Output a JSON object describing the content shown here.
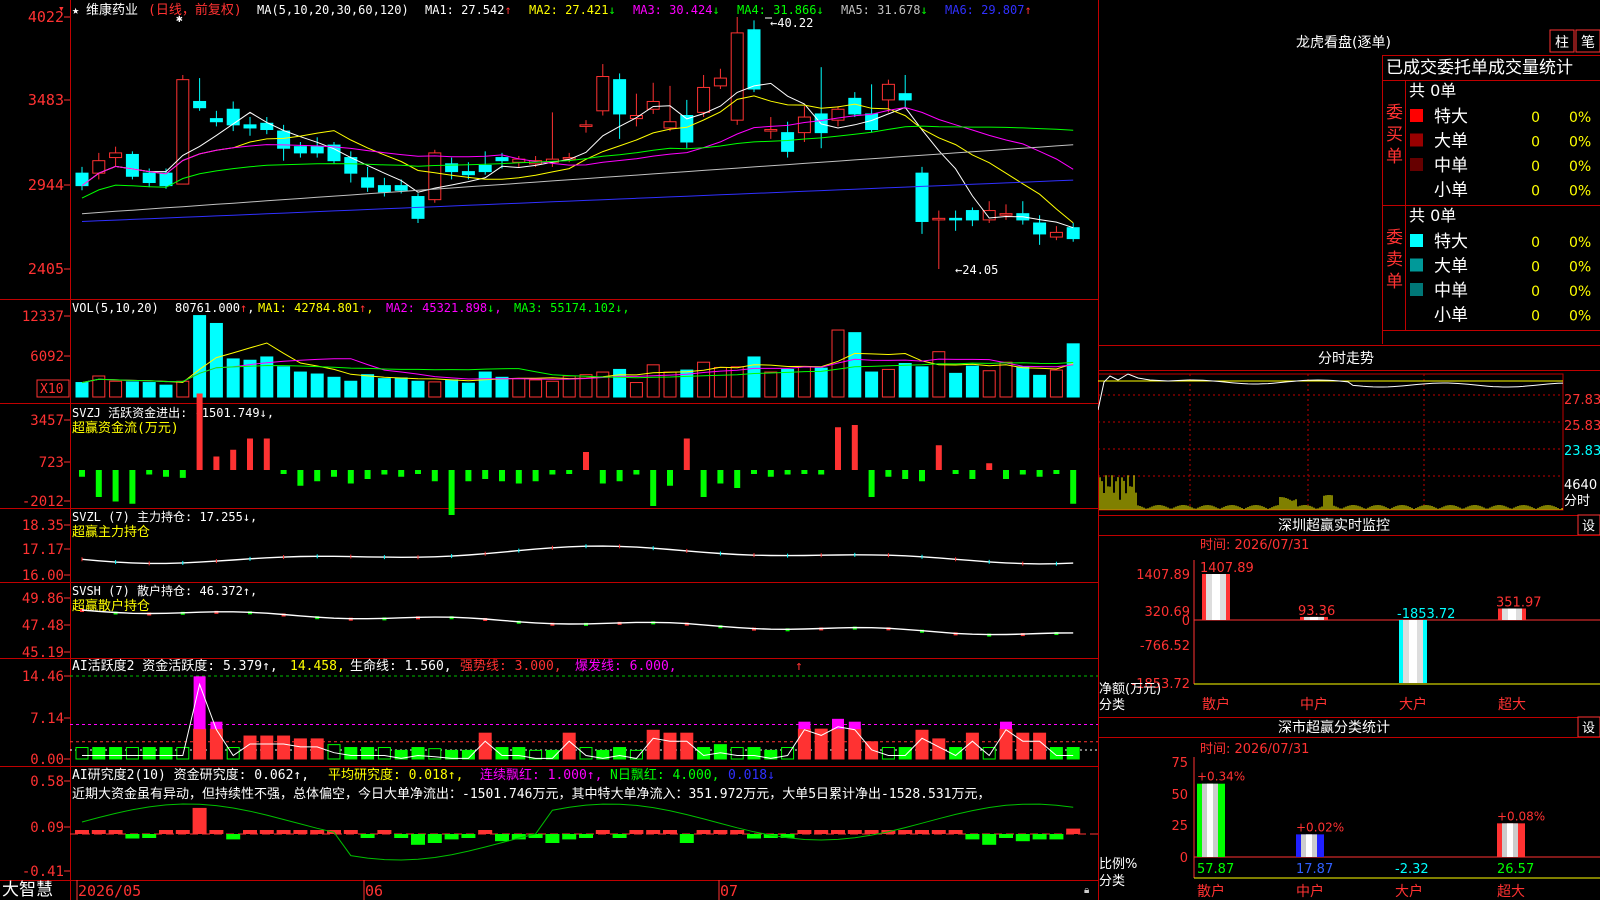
{
  "app": {
    "name": "大智慧"
  },
  "stock": {
    "star": "★",
    "name": "维康药业",
    "period": "(日线，前复权)"
  },
  "colors": {
    "up": "#ff3232",
    "down": "#00ffff",
    "grid": "#a00000",
    "axis": "#ff3232",
    "bg": "#000000"
  },
  "kline": {
    "ma_header": "MA(5,10,20,30,60,120)",
    "ma": [
      {
        "label": "MA1: 27.542",
        "arrow": "↑",
        "color": "#ffffff"
      },
      {
        "label": "MA2: 27.421",
        "arrow": "↓",
        "color": "#ffff00"
      },
      {
        "label": "MA3: 30.424",
        "arrow": "↓",
        "color": "#ff00ff"
      },
      {
        "label": "MA4: 31.866",
        "arrow": "↓",
        "color": "#00ff00"
      },
      {
        "label": "MA5: 31.678",
        "arrow": "↓",
        "color": "#c0c0c0"
      },
      {
        "label": "MA6: 29.807",
        "arrow": "↑",
        "color": "#3030ff"
      }
    ],
    "price_axis": [
      "4022",
      "3483",
      "2944",
      "2405"
    ],
    "high_label": "40.22",
    "low_label": "←24.05"
  },
  "volume": {
    "header": "VOL(5,10,20)",
    "value": "80761.000",
    "ma": [
      {
        "label": "MA1: 42784.801",
        "arrow": "↑",
        "color": "#ffff00"
      },
      {
        "label": "MA2: 45321.898",
        "arrow": "↓",
        "color": "#ff00ff"
      },
      {
        "label": "MA3: 55174.102",
        "arrow": "↓",
        "color": "#00ff00"
      }
    ],
    "axis": [
      "12337",
      "6092"
    ],
    "unit": "X10"
  },
  "svzj": {
    "header": "SVZJ  活跃资金进出: -1501.749↓,",
    "sub": "超赢资金流(万元)",
    "axis": [
      "3457",
      "723",
      "-2012"
    ]
  },
  "svzl": {
    "header": "SVZL (7) 主力持仓: 17.255↓,",
    "sub": "超赢主力持仓",
    "axis": [
      "18.35",
      "17.17",
      "16.00"
    ]
  },
  "svsh": {
    "header": "SVSH (7) 散户持仓: 46.372↑,",
    "sub": "超赢散户持仓",
    "axis": [
      "49.86",
      "47.48",
      "45.19"
    ]
  },
  "ai_active": {
    "parts": [
      {
        "text": "AI活跃度2 资金活跃度: 5.379↑,",
        "color": "#ffffff"
      },
      {
        "text": "14.458,",
        "color": "#ffff00"
      },
      {
        "text": "生命线: 1.560,",
        "color": "#ffffff"
      },
      {
        "text": "强势线: 3.000,",
        "color": "#ff3232"
      },
      {
        "text": "爆发线: 6.000,",
        "color": "#ff00ff"
      }
    ],
    "axis": [
      "14.46",
      "7.14",
      "0.00"
    ]
  },
  "ai_research": {
    "parts": [
      {
        "text": "AI研究度2(10) 资金研究度: 0.062↑,",
        "color": "#ffffff"
      },
      {
        "text": "平均研究度: 0.018↑,",
        "color": "#ffff00"
      },
      {
        "text": "连续飘红: 1.000↑,",
        "color": "#ff00ff"
      },
      {
        "text": "N日飘红: 4.000,",
        "color": "#00ff00"
      },
      {
        "text": "0.018↓",
        "color": "#3030ff"
      }
    ],
    "comment": "近期大资金虽有异动，但持续性不强，总体偏空，今日大单净流出：-1501.746万元，其中特大单净流入：351.972万元，大单5日累计净出-1528.531万元，",
    "axis": [
      "0.58",
      "0.09",
      "-0.41"
    ]
  },
  "dates": [
    "2026/05",
    "06",
    "07"
  ],
  "side": {
    "lhb": {
      "title": "龙虎看盘(逐单)",
      "btn1": "柱",
      "btn2": "笔",
      "table_title": "已成交委托单成交量统计",
      "buy": {
        "label": "委买单",
        "total": "共 0单",
        "rows": [
          {
            "name": "特大",
            "vol": "0",
            "pct": "0%",
            "color": "#ff0000"
          },
          {
            "name": "大单",
            "vol": "0",
            "pct": "0%",
            "color": "#990000"
          },
          {
            "name": "中单",
            "vol": "0",
            "pct": "0%",
            "color": "#660000"
          },
          {
            "name": "小单",
            "vol": "0",
            "pct": "0%",
            "color": ""
          }
        ]
      },
      "sell": {
        "label": "委卖单",
        "total": "共 0单",
        "rows": [
          {
            "name": "特大",
            "vol": "0",
            "pct": "0%",
            "color": "#00ffff"
          },
          {
            "name": "大单",
            "vol": "0",
            "pct": "0%",
            "color": "#009999"
          },
          {
            "name": "中单",
            "vol": "0",
            "pct": "0%",
            "color": "#007777"
          },
          {
            "name": "小单",
            "vol": "0",
            "pct": "0%",
            "color": ""
          }
        ]
      }
    },
    "minute": {
      "title": "分时走势",
      "axis": [
        "27.83",
        "25.83",
        "23.83"
      ],
      "vol_label": "4640",
      "unit_label": "分时"
    },
    "sz_monitor": {
      "title": "深圳超赢实时监控",
      "set": "设",
      "time": "时间: 2026/07/31",
      "axis": [
        "1407.89",
        "320.69",
        "0",
        "-766.52",
        "-1853.72"
      ],
      "ylabel1": "净额(万元)",
      "ylabel2": "分类",
      "bars": [
        {
          "cat": "散户",
          "value": 1407.89,
          "label": "1407.89",
          "color": "#ff3232"
        },
        {
          "cat": "中户",
          "value": 93.36,
          "label": "93.36",
          "color": "#ff3232"
        },
        {
          "cat": "大户",
          "value": -1853.72,
          "label": "-1853.72",
          "color": "#00ffff"
        },
        {
          "cat": "超大",
          "value": 351.97,
          "label": "351.97",
          "color": "#ff3232"
        }
      ]
    },
    "sz_class": {
      "title": "深市超赢分类统计",
      "set": "设",
      "time": "时间: 2026/07/31",
      "axis": [
        "75",
        "50",
        "25",
        "0"
      ],
      "ylabel1": "比例%",
      "ylabel2": "分类",
      "bars": [
        {
          "cat": "散户",
          "value": 57.87,
          "top": "+0.34%",
          "bottom": "57.87",
          "fill": "#00ff00"
        },
        {
          "cat": "中户",
          "value": 17.87,
          "top": "+0.02%",
          "bottom": "17.87",
          "fill": "#2020ff"
        },
        {
          "cat": "大户",
          "value": -2.32,
          "top": "",
          "bottom": "-2.32",
          "fill": "#00ffff"
        },
        {
          "cat": "超大",
          "value": 26.57,
          "top": "+0.08%",
          "bottom": "26.57",
          "fill": "#ff3232"
        }
      ]
    }
  }
}
